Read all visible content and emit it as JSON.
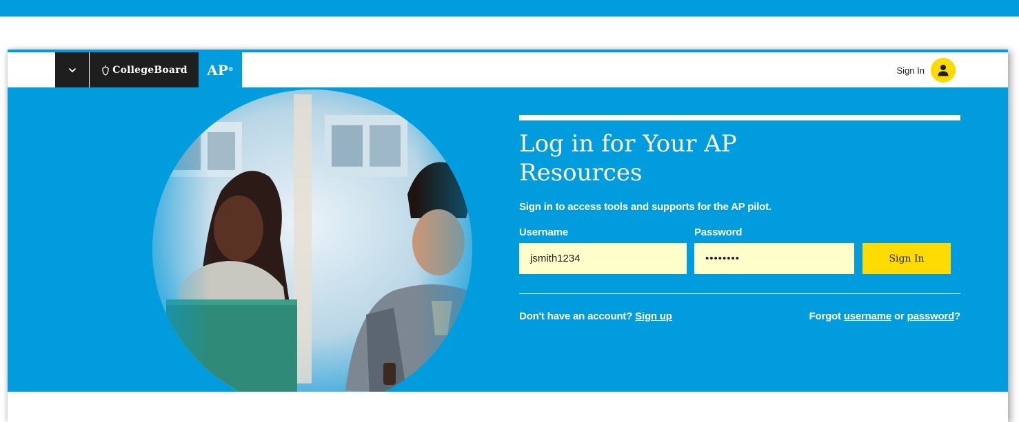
{
  "colors": {
    "brand_blue": "#009cde",
    "nav_dark": "#1e1e1e",
    "accent_yellow": "#fedb00",
    "input_bg": "#ffffcc"
  },
  "navbar": {
    "dropdown_icon": "chevron-down-icon",
    "brand_logo_icon": "acorn-icon",
    "brand_name": "CollegeBoard",
    "program_label": "AP",
    "program_mark": "®",
    "sign_in_label": "Sign In",
    "account_icon": "user-icon"
  },
  "login": {
    "title": "Log in for Your AP Resources",
    "subtitle": "Sign in to access tools and supports for the AP pilot.",
    "username": {
      "label": "Username",
      "value": "jsmith1234"
    },
    "password": {
      "label": "Password",
      "value": "jsmith12"
    },
    "submit_label": "Sign In",
    "no_account_text": "Don't have an account? ",
    "sign_up_link": "Sign up",
    "forgot_prefix": "Forgot ",
    "forgot_username_link": "username",
    "forgot_or": " or ",
    "forgot_password_link": "password",
    "forgot_suffix": "?"
  }
}
